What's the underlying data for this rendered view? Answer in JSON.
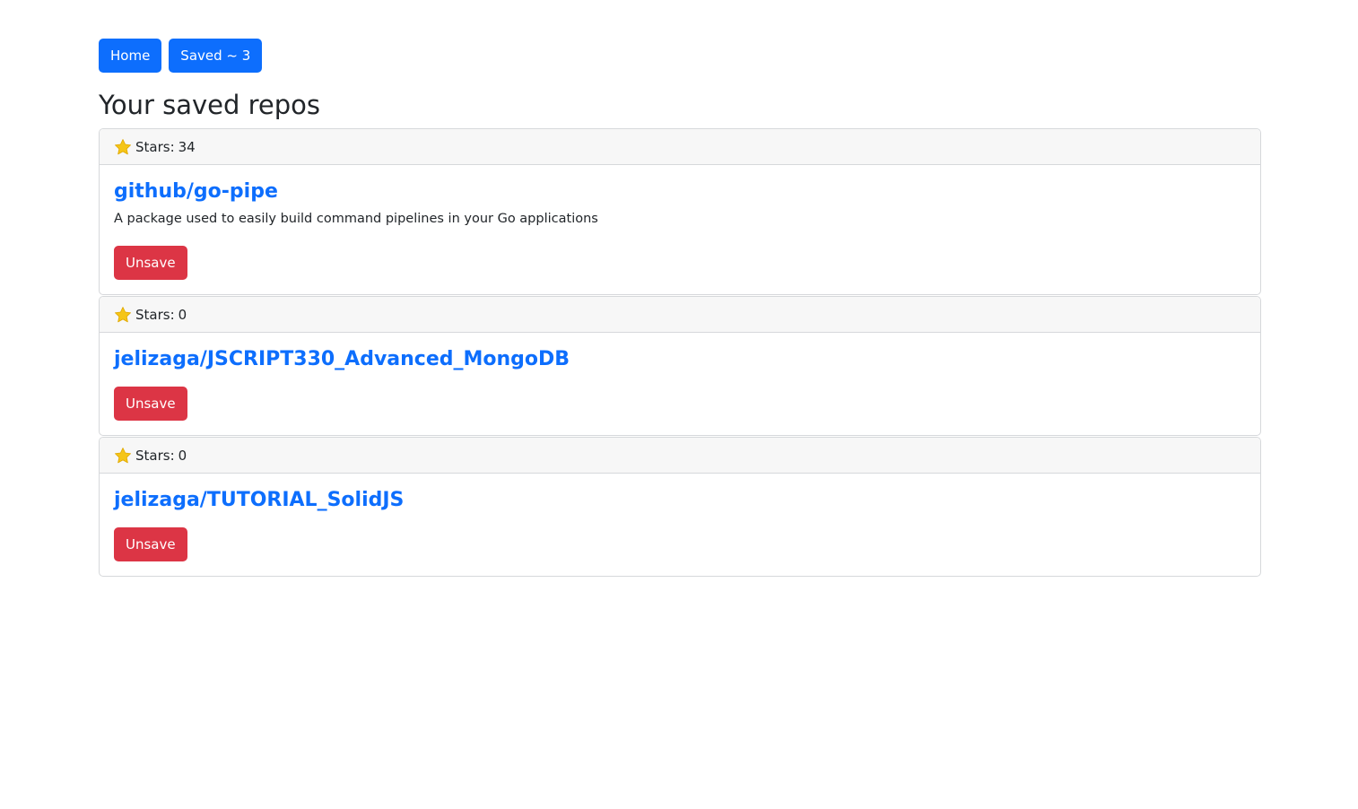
{
  "nav": {
    "home_label": "Home",
    "saved_label": "Saved ~ 3"
  },
  "page": {
    "title": "Your saved repos"
  },
  "repos": [
    {
      "stars_label": "Stars:",
      "stars": "34",
      "name": "github/go-pipe",
      "description": "A package used to easily build command pipelines in your Go applications",
      "action_label": "Unsave"
    },
    {
      "stars_label": "Stars:",
      "stars": "0",
      "name": "jelizaga/JSCRIPT330_Advanced_MongoDB",
      "description": "",
      "action_label": "Unsave"
    },
    {
      "stars_label": "Stars:",
      "stars": "0",
      "name": "jelizaga/TUTORIAL_SolidJS",
      "description": "",
      "action_label": "Unsave"
    }
  ],
  "icons": {
    "star": "star-icon"
  },
  "colors": {
    "primary": "#0d6efd",
    "danger": "#dc3545",
    "star": "#f5c518",
    "card_header_bg": "#f7f7f7"
  }
}
